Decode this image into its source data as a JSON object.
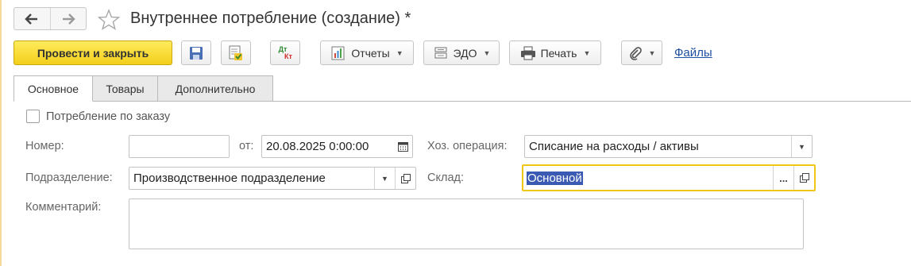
{
  "window": {
    "title": "Внутреннее потребление (создание) *"
  },
  "toolbar": {
    "post_and_close": "Провести и закрыть",
    "reports": "Отчеты",
    "edo": "ЭДО",
    "print": "Печать",
    "files": "Файлы",
    "dt_kt_top": "Дт",
    "dt_kt_bottom": "Кт"
  },
  "tabs": [
    {
      "label": "Основное",
      "active": true
    },
    {
      "label": "Товары",
      "active": false
    },
    {
      "label": "Дополнительно",
      "active": false
    }
  ],
  "form": {
    "by_order_label": "Потребление по заказу",
    "by_order_checked": false,
    "number_label": "Номер:",
    "number_value": "",
    "date_label": "от:",
    "date_value": "20.08.2025  0:00:00",
    "operation_label": "Хоз. операция:",
    "operation_value": "Списание на расходы / активы",
    "division_label": "Подразделение:",
    "division_value": "Производственное подразделение",
    "warehouse_label": "Склад:",
    "warehouse_value": "Основной",
    "comment_label": "Комментарий:",
    "comment_value": "",
    "ellipsis": "..."
  },
  "icons": [
    "back-arrow-icon",
    "forward-arrow-icon",
    "favorite-star-icon",
    "save-disk-icon",
    "post-document-icon",
    "dt-kt-icon",
    "reports-icon",
    "edo-icon",
    "printer-icon",
    "paperclip-icon",
    "calendar-icon",
    "open-icon"
  ],
  "colors": {
    "primary_button": "#f3cf1b",
    "focus_border": "#f0c814",
    "selection": "#3a5ab3",
    "link": "#1f4ea3"
  }
}
